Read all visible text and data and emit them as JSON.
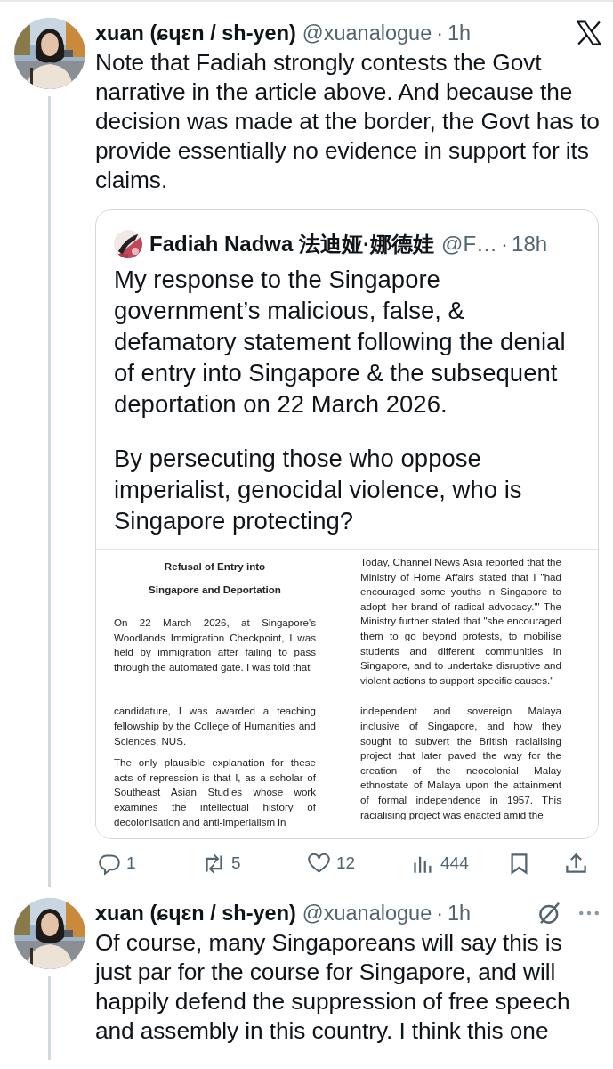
{
  "tweets": [
    {
      "avatar": {
        "kind": "picture"
      },
      "name": "xuan (ɕɥɛn / sh-yen)",
      "handle": "@xuanalogue",
      "separator": "·",
      "time": "1h",
      "header_icons": [
        {
          "kind": "x"
        }
      ],
      "thread_below": true,
      "text": "Note that Fadiah strongly contests the Govt narrative in the article above. And because the decision was made at the border, the Govt has to provide essentially no evidence in support for its claims.",
      "quote": {
        "avatar": {
          "kind": "picture"
        },
        "name": "Fadiah Nadwa 法迪娅·娜德娃",
        "handle": "@F…",
        "separator": "·",
        "time": "18h",
        "paragraphs": [
          "My response to the Singapore government’s malicious, false, & defamatory statement following the denial of entry into Singapore & the subsequent deportation on 22 March 2026.",
          "By persecuting those who oppose imperialist, genocidal violence, who is Singapore protecting?"
        ],
        "document": {
          "tiles": [
            {
              "blocks": [
                {
                  "kind": "heading",
                  "text": "Refusal of Entry into"
                },
                {
                  "kind": "heading",
                  "text": "Singapore and Deportation"
                },
                {
                  "kind": "paragraph",
                  "text": "On 22 March 2026, at Singapore's Woodlands Immigration Checkpoint, I was held by immigration after failing to pass through the automated gate. I was told that"
                }
              ]
            },
            {
              "blocks": [
                {
                  "kind": "paragraph",
                  "text": "Today, Channel News Asia reported that the Ministry of Home Affairs stated that I \"had encouraged some youths in Singapore to adopt 'her brand of radical advocacy.'\" The Ministry further stated that \"she encouraged them to go beyond protests, to mobilise students and different communities in Singapore, and to undertake disruptive and violent actions to support specific causes.\""
                }
              ]
            },
            {
              "blocks": [
                {
                  "kind": "paragraph",
                  "text": "candidature, I was awarded a teaching fellowship by the College of Humanities and Sciences, NUS."
                },
                {
                  "kind": "paragraph",
                  "text": "The only plausible explanation for these acts of repression is that I, as a scholar of Southeast Asian Studies whose work examines the intellectual history of decolonisation and anti-imperialism in"
                }
              ]
            },
            {
              "blocks": [
                {
                  "kind": "paragraph",
                  "text": "independent and sovereign Malaya inclusive of Singapore, and how they sought to subvert the British racialising project that later paved the way for the creation of the neocolonial Malay ethnostate of Malaya upon the attainment of formal independence in 1957. This racialising project was enacted amid the"
                }
              ]
            }
          ]
        }
      },
      "actions": [
        {
          "kind": "reply",
          "count": "1"
        },
        {
          "kind": "repost",
          "count": "5"
        },
        {
          "kind": "like",
          "count": "12"
        },
        {
          "kind": "views",
          "count": "444"
        },
        {
          "kind": "bookmark"
        },
        {
          "kind": "share"
        }
      ]
    },
    {
      "avatar": {
        "kind": "picture"
      },
      "name": "xuan (ɕɥɛn / sh-yen)",
      "handle": "@xuanalogue",
      "separator": "·",
      "time": "1h",
      "header_icons": [
        {
          "kind": "grok"
        },
        {
          "kind": "more"
        }
      ],
      "thread_below": true,
      "text": "Of course, many Singaporeans will say this is just par for the course for Singapore, and will happily defend the suppression of free speech and assembly in this country. I think this one"
    }
  ]
}
